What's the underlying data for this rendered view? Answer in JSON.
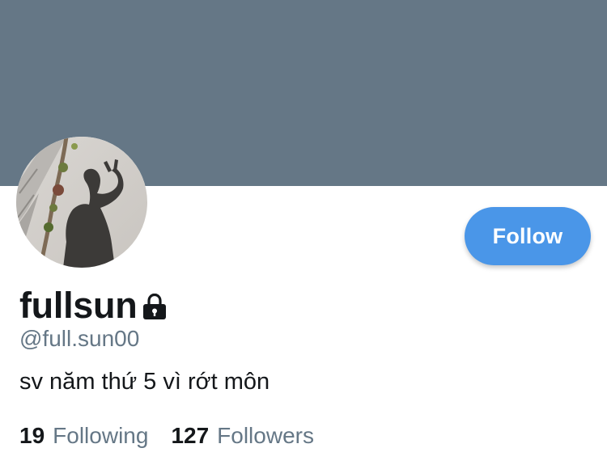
{
  "header": {
    "banner_color": "#657786"
  },
  "profile": {
    "avatar_alt": "shadow-selfie",
    "display_name": "fullsun",
    "protected_icon": "lock-icon",
    "handle": "@full.sun00",
    "bio": "sv năm thứ 5 vì rớt môn"
  },
  "actions": {
    "follow_label": "Follow",
    "follow_color": "#4a96e8"
  },
  "stats": {
    "following_count": "19",
    "following_label": "Following",
    "followers_count": "127",
    "followers_label": "Followers"
  }
}
